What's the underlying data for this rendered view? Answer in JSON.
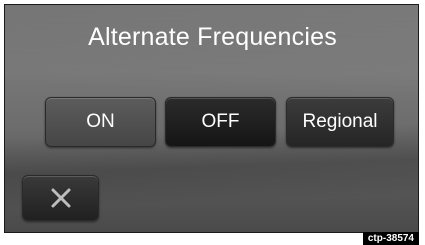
{
  "dialog": {
    "title": "Alternate Frequencies",
    "options": {
      "on_label": "ON",
      "off_label": "OFF",
      "regional_label": "Regional"
    },
    "close_icon": "close-icon"
  },
  "figure_tag": "ctp-38574"
}
